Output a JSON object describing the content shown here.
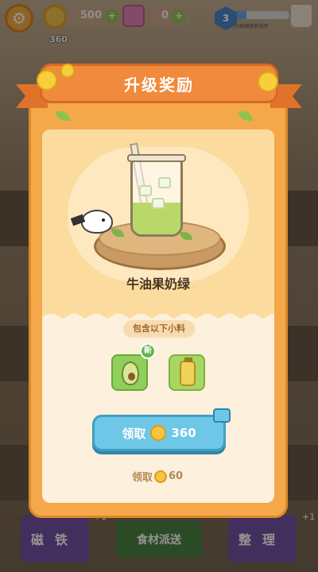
{
  "topbar": {
    "coins": "500",
    "gems": "0",
    "level": "3",
    "level_progress": 0.25,
    "level_text": "10级解锁新城市",
    "coin_floating": "360",
    "plus": "+"
  },
  "dialog": {
    "title": "升级奖励",
    "drink_name": "牛油果奶绿",
    "contains_label": "包含以下小料",
    "new_badge": "新",
    "ingredients": [
      {
        "icon": "avocado-icon",
        "is_new": true
      },
      {
        "icon": "tea-bottle-icon",
        "is_new": false
      }
    ],
    "claim_button": {
      "label": "领取",
      "amount": "360"
    },
    "claim_plain": {
      "label": "领取",
      "amount": "60"
    }
  },
  "bottom_bar": {
    "magnet_label": "磁铁",
    "deliver_label": "食材派送",
    "sort_label": "整理",
    "video_plus_left": "+1",
    "video_plus_right": "+1"
  }
}
